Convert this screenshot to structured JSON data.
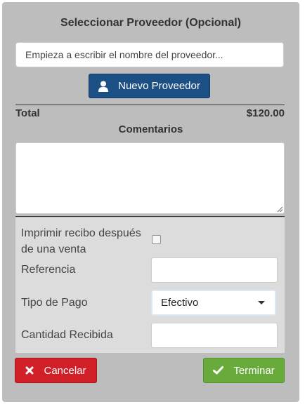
{
  "supplier": {
    "title": "Seleccionar Proveedor (Opcional)",
    "search_placeholder": "Empieza a escribir el nombre del proveedor...",
    "new_supplier_label": "Nuevo Proveedor",
    "new_supplier_icon": "user-icon"
  },
  "totals": {
    "label": "Total",
    "value": "$120.00"
  },
  "comments": {
    "title": "Comentarios",
    "value": ""
  },
  "form": {
    "print_receipt_label": "Imprimir recibo después de una venta",
    "print_receipt_checked": false,
    "reference_label": "Referencia",
    "reference_value": "",
    "payment_type_label": "Tipo de Pago",
    "payment_type_value": "Efectivo",
    "amount_received_label": "Cantidad Recibida",
    "amount_received_value": ""
  },
  "actions": {
    "cancel_label": "Cancelar",
    "cancel_icon": "close-icon",
    "cancel_color": "#d01f27",
    "finish_label": "Terminar",
    "finish_icon": "check-icon",
    "finish_color": "#69aa3d"
  },
  "colors": {
    "primary": "#1c4f84",
    "panel_bg": "#bdbdbd",
    "form_bg": "#dcdcdc"
  }
}
